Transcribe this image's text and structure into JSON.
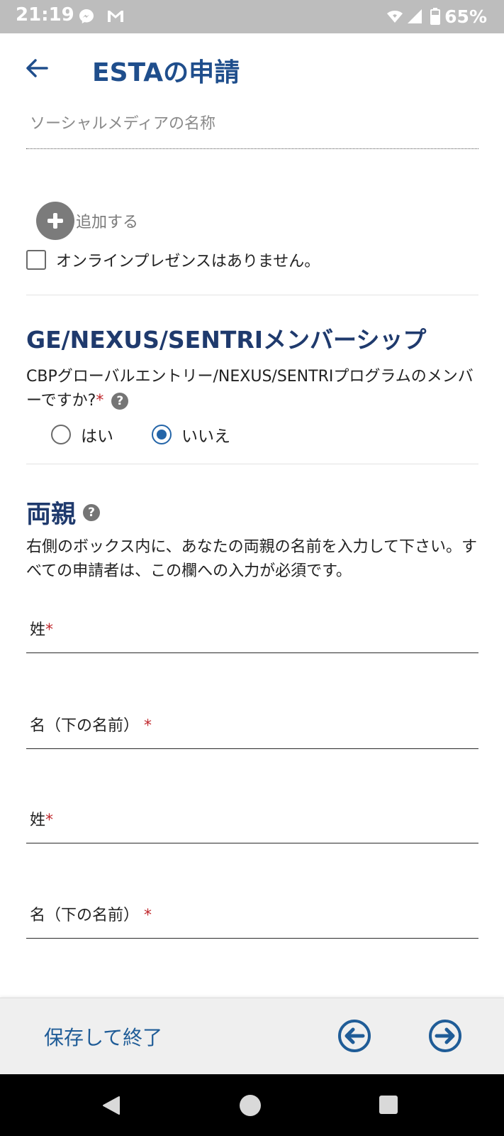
{
  "status_bar": {
    "time": "21:19",
    "battery": "65%"
  },
  "header": {
    "title": "ESTAの申請"
  },
  "social_media": {
    "placeholder": "ソーシャルメディアの名称"
  },
  "add_button": {
    "label": "追加する"
  },
  "no_online_presence": {
    "label": "オンラインプレゼンスはありません。",
    "checked": false
  },
  "ge_section": {
    "heading": "GE/NEXUS/SENTRIメンバーシップ",
    "question": "CBPグローバルエントリー/NEXUS/SENTRIプログラムのメンバーですか?",
    "required_mark": "*",
    "help": "?",
    "options": [
      {
        "label": "はい",
        "selected": false
      },
      {
        "label": "いいえ",
        "selected": true
      }
    ]
  },
  "parents_section": {
    "heading": "両親",
    "help": "?",
    "description": "右側のボックス内に、あなたの両親の名前を入力して下さい。すべての申請者は、この欄への入力が必須です。",
    "fields": [
      {
        "label": "姓",
        "required_mark": "*"
      },
      {
        "label": "名（下の名前）",
        "required_mark": "*"
      },
      {
        "label": "姓",
        "required_mark": "*"
      },
      {
        "label": "名（下の名前）",
        "required_mark": "*"
      }
    ]
  },
  "bottom_bar": {
    "save_exit_label": "保存して終了"
  },
  "colors": {
    "accent": "#1f4e8c",
    "heading": "#1f3a6d",
    "required": "#c0282d",
    "radio_selected": "#2465a8"
  },
  "icons": [
    "back-arrow-icon",
    "messenger-icon",
    "gmail-icon",
    "wifi-icon",
    "signal-icon",
    "battery-icon",
    "add-icon",
    "help-icon",
    "prev-arrow-icon",
    "next-arrow-icon",
    "nav-back-icon",
    "nav-home-icon",
    "nav-recents-icon"
  ]
}
